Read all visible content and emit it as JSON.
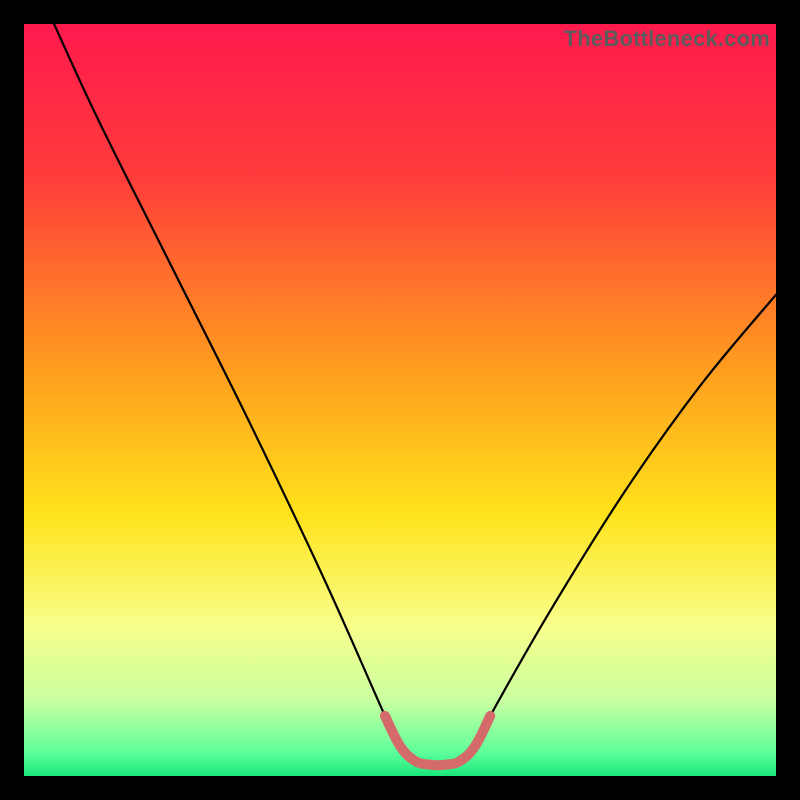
{
  "watermark": "TheBottleneck.com",
  "chart_data": {
    "type": "line",
    "title": "",
    "xlabel": "",
    "ylabel": "",
    "xlim": [
      0,
      100
    ],
    "ylim": [
      0,
      100
    ],
    "series": [
      {
        "name": "curve",
        "x": [
          4,
          10,
          20,
          30,
          40,
          48,
          50,
          52,
          54,
          56,
          58,
          60,
          62,
          70,
          80,
          90,
          100
        ],
        "values": [
          100,
          87,
          67,
          47,
          26,
          8,
          4,
          2,
          1.5,
          1.5,
          2,
          4,
          8,
          22,
          38,
          52,
          64
        ]
      }
    ],
    "highlight_segment": {
      "name": "valley",
      "color": "#d46a6a",
      "x": [
        48,
        50,
        52,
        54,
        56,
        58,
        60,
        62
      ],
      "values": [
        8,
        4,
        2,
        1.5,
        1.5,
        2,
        4,
        8
      ]
    },
    "background_gradient": {
      "stops": [
        {
          "offset": 0,
          "color": "#ff1a4d"
        },
        {
          "offset": 20,
          "color": "#ff3b3b"
        },
        {
          "offset": 45,
          "color": "#ff9a1f"
        },
        {
          "offset": 65,
          "color": "#ffe21a"
        },
        {
          "offset": 80,
          "color": "#f8ff8a"
        },
        {
          "offset": 90,
          "color": "#c9ffa1"
        },
        {
          "offset": 97,
          "color": "#5cff9a"
        },
        {
          "offset": 100,
          "color": "#19e87a"
        }
      ]
    }
  }
}
